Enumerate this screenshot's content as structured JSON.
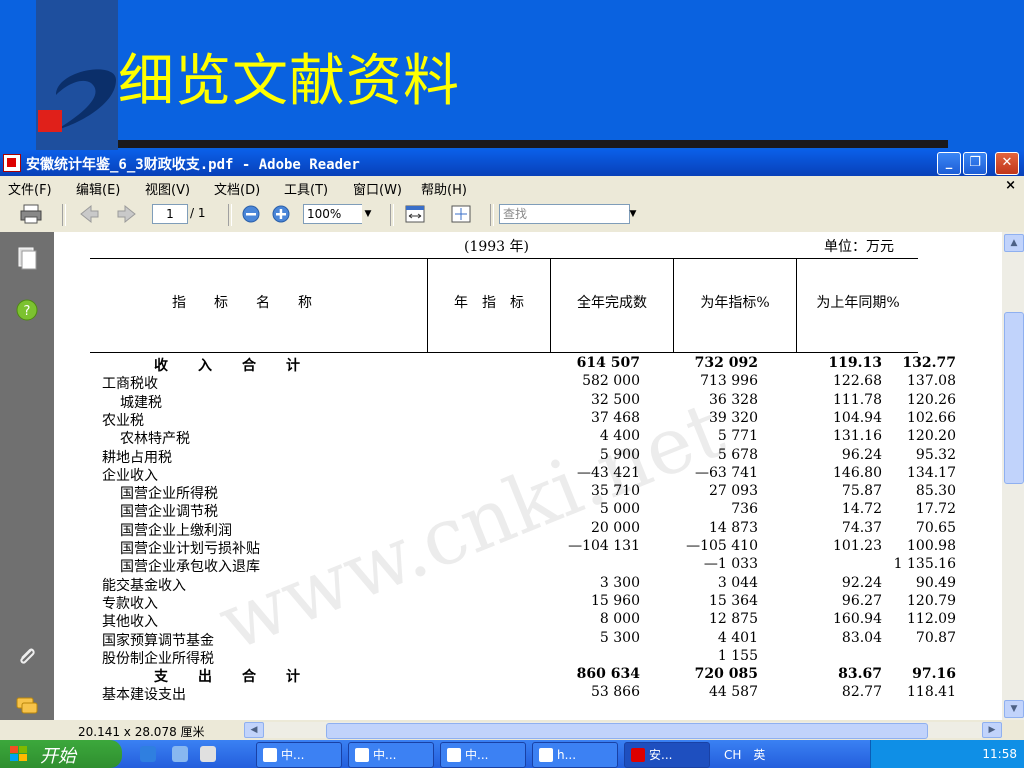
{
  "slide": {
    "title": "细览文献资料"
  },
  "window": {
    "title": "安徽统计年鉴_6_3财政收支.pdf - Adobe Reader",
    "menu": [
      "文件(F)",
      "编辑(E)",
      "视图(V)",
      "文档(D)",
      "工具(T)",
      "窗口(W)",
      "帮助(H)"
    ],
    "close_doc": "×",
    "toolbar": {
      "page_current": "1",
      "page_total": "/ 1",
      "zoom": "100%",
      "find_placeholder": "查找"
    },
    "status": {
      "dimensions": "20.141 x 28.078 厘米"
    }
  },
  "table": {
    "year": "(1993 年)",
    "unit": "单位：万元",
    "headers": [
      "指　　标　　名　　称",
      "年　指　标",
      "全年完成数",
      "为年指标%",
      "为上年同期%"
    ],
    "rows": [
      {
        "name": "收入合计",
        "v1": "614 507",
        "v2": "732 092",
        "v3": "119.13",
        "v4": "132.77",
        "indent": 0,
        "total": true
      },
      {
        "name": "工商税收",
        "v1": "582 000",
        "v2": "713 996",
        "v3": "122.68",
        "v4": "137.08",
        "indent": 0
      },
      {
        "name": "城建税",
        "v1": "32 500",
        "v2": "36 328",
        "v3": "111.78",
        "v4": "120.26",
        "indent": 1
      },
      {
        "name": "农业税",
        "v1": "37 468",
        "v2": "39 320",
        "v3": "104.94",
        "v4": "102.66",
        "indent": 0
      },
      {
        "name": "农林特产税",
        "v1": "4 400",
        "v2": "5 771",
        "v3": "131.16",
        "v4": "120.20",
        "indent": 1
      },
      {
        "name": "耕地占用税",
        "v1": "5 900",
        "v2": "5 678",
        "v3": "96.24",
        "v4": "95.32",
        "indent": 0
      },
      {
        "name": "企业收入",
        "v1": "—43 421",
        "v2": "—63 741",
        "v3": "146.80",
        "v4": "134.17",
        "indent": 0
      },
      {
        "name": "国营企业所得税",
        "v1": "35 710",
        "v2": "27 093",
        "v3": "75.87",
        "v4": "85.30",
        "indent": 1
      },
      {
        "name": "国营企业调节税",
        "v1": "5 000",
        "v2": "736",
        "v3": "14.72",
        "v4": "17.72",
        "indent": 1
      },
      {
        "name": "国营企业上缴利润",
        "v1": "20 000",
        "v2": "14 873",
        "v3": "74.37",
        "v4": "70.65",
        "indent": 1
      },
      {
        "name": "国营企业计划亏损补贴",
        "v1": "—104 131",
        "v2": "—105 410",
        "v3": "101.23",
        "v4": "100.98",
        "indent": 1
      },
      {
        "name": "国营企业承包收入退库",
        "v1": "",
        "v2": "—1 033",
        "v3": "",
        "v4": "1 135.16",
        "indent": 1
      },
      {
        "name": "能交基金收入",
        "v1": "3 300",
        "v2": "3 044",
        "v3": "92.24",
        "v4": "90.49",
        "indent": 0
      },
      {
        "name": "专款收入",
        "v1": "15 960",
        "v2": "15 364",
        "v3": "96.27",
        "v4": "120.79",
        "indent": 0
      },
      {
        "name": "其他收入",
        "v1": "8 000",
        "v2": "12 875",
        "v3": "160.94",
        "v4": "112.09",
        "indent": 0
      },
      {
        "name": "国家预算调节基金",
        "v1": "5 300",
        "v2": "4 401",
        "v3": "83.04",
        "v4": "70.87",
        "indent": 0
      },
      {
        "name": "股份制企业所得税",
        "v1": "",
        "v2": "1 155",
        "v3": "",
        "v4": "",
        "indent": 0
      },
      {
        "name": "支出合计",
        "v1": "860 634",
        "v2": "720 085",
        "v3": "83.67",
        "v4": "97.16",
        "indent": 0,
        "total": true
      },
      {
        "name": "基本建设支出",
        "v1": "53 866",
        "v2": "44 587",
        "v3": "82.77",
        "v4": "118.41",
        "indent": 0
      }
    ]
  },
  "watermark": "www.cnki.net",
  "taskbar": {
    "start": "开始",
    "tasks": [
      "中...",
      "中...",
      "中...",
      "h...",
      "安..."
    ],
    "ime": "CH",
    "ime_lang": "英",
    "clock": "11:58"
  }
}
